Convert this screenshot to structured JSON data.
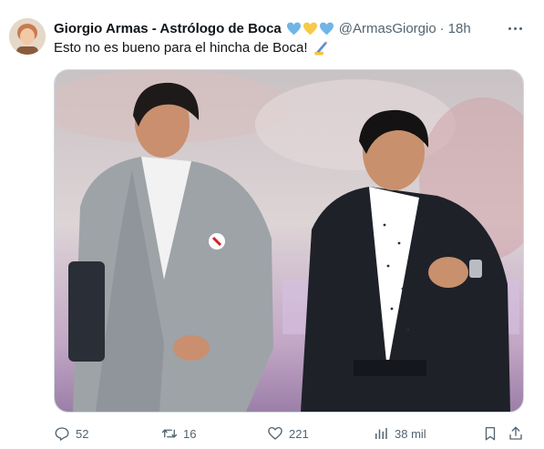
{
  "tweet": {
    "author_name": "Giorgio Armas - Astrólogo de Boca",
    "name_hearts": [
      "blue-heart-icon",
      "yellow-heart-icon",
      "blue-heart-icon"
    ],
    "handle": "@ArmasGiorgio",
    "separator": "·",
    "time": "18h",
    "text": "Esto no es bueno para el hincha de Boca!",
    "text_emoji": "writing-hand-icon"
  },
  "actions": {
    "replies": "52",
    "retweets": "16",
    "likes": "221",
    "views": "38 mil"
  },
  "colors": {
    "text": "#0f1419",
    "secondary": "#536471",
    "heart_blue": "#6fb6e7",
    "heart_yellow": "#f7c948",
    "border": "#cfd9de"
  }
}
